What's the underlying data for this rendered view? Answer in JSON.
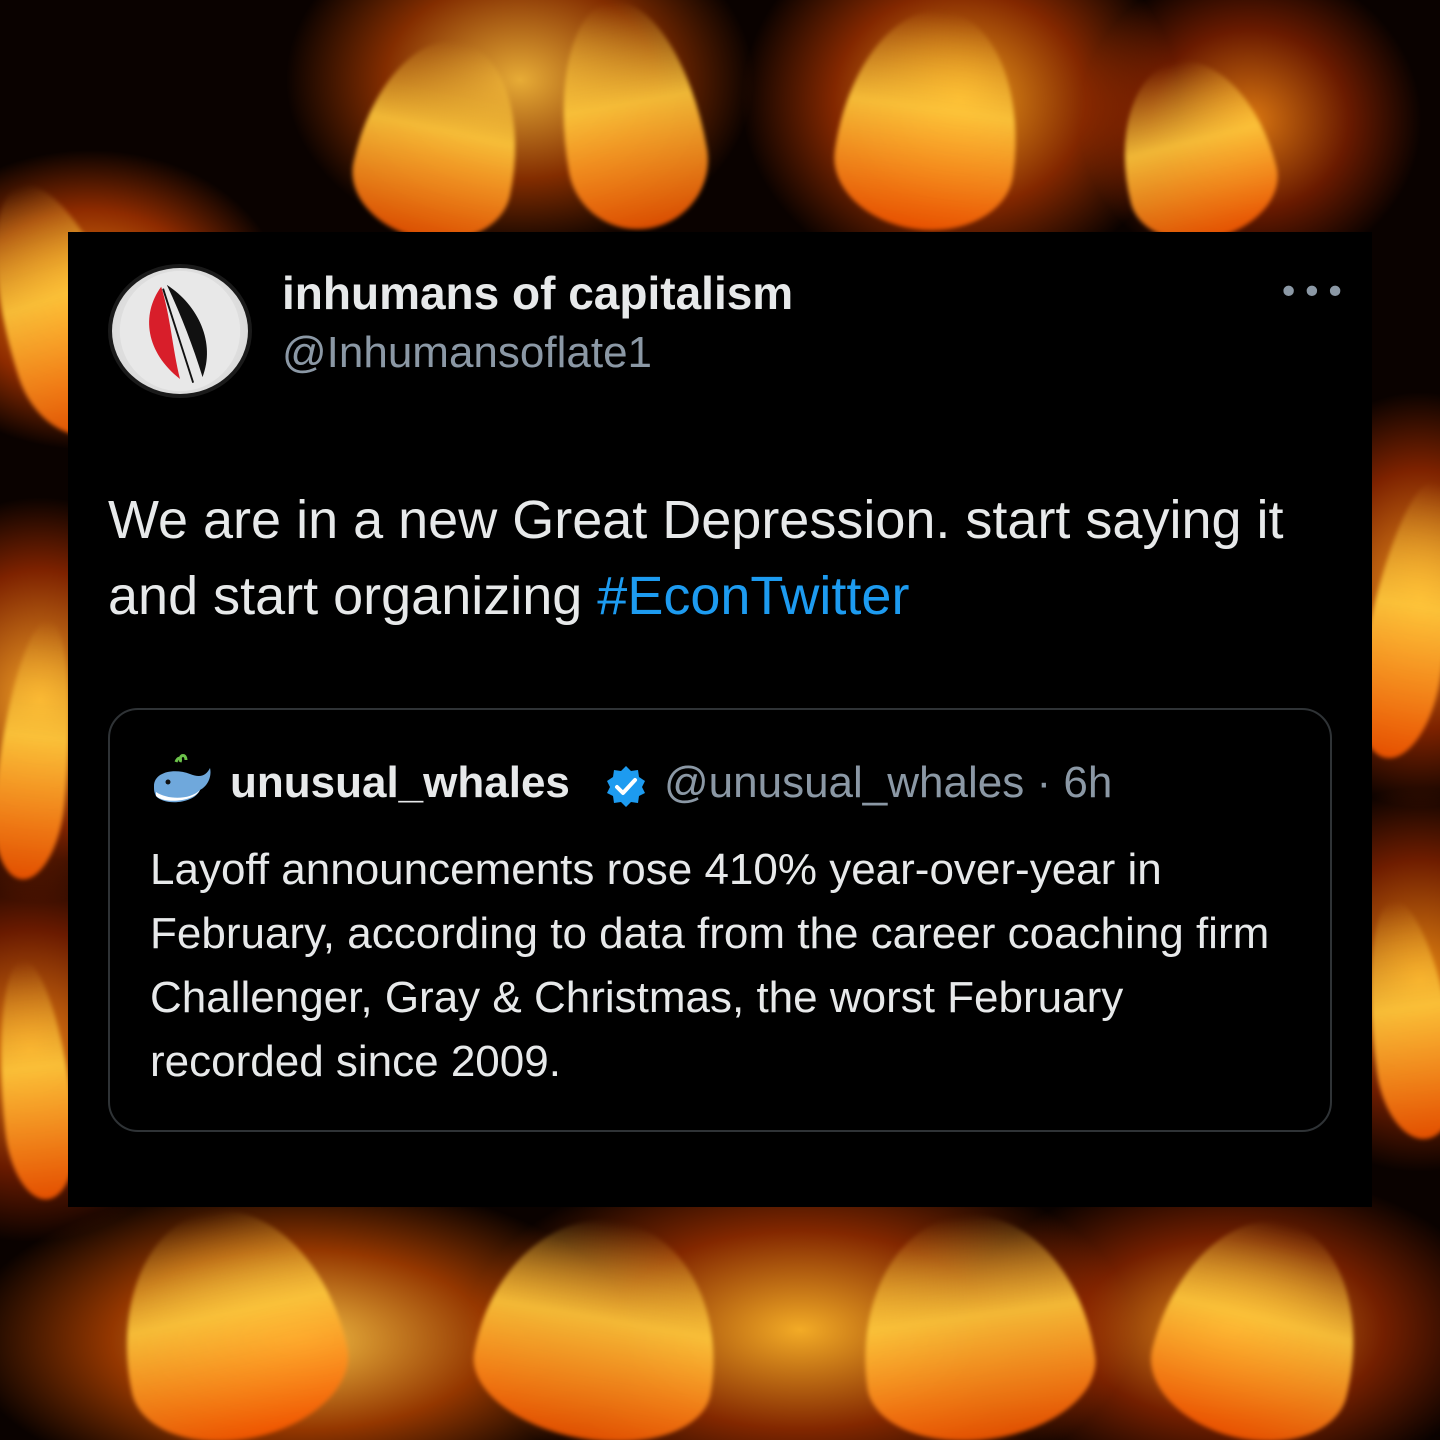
{
  "post": {
    "display_name": "inhumans of capitalism",
    "handle": "@Inhumansoflate1",
    "more_label": "•••",
    "text": "We are in a new Great Depression.  start saying it and start organizing ",
    "hashtag": "#EconTwitter"
  },
  "quoted_post": {
    "display_name": "unusual_whales",
    "handle": "@unusual_whales",
    "separator": " · ",
    "time": "6h",
    "text": "Layoff announcements rose 410% year-over-year in February, according to data from the career coaching firm Challenger, Gray & Christmas, the worst February recorded since 2009."
  },
  "icons": {
    "avatar": "feather-logo-icon",
    "quoted_avatar": "whale-icon",
    "verified": "verified-badge-icon",
    "more": "more-options-icon"
  },
  "colors": {
    "background_card": "#000000",
    "text_primary": "#e7e9ea",
    "text_secondary": "#8b98a5",
    "link": "#1d9bf0",
    "border": "#2f3336"
  }
}
